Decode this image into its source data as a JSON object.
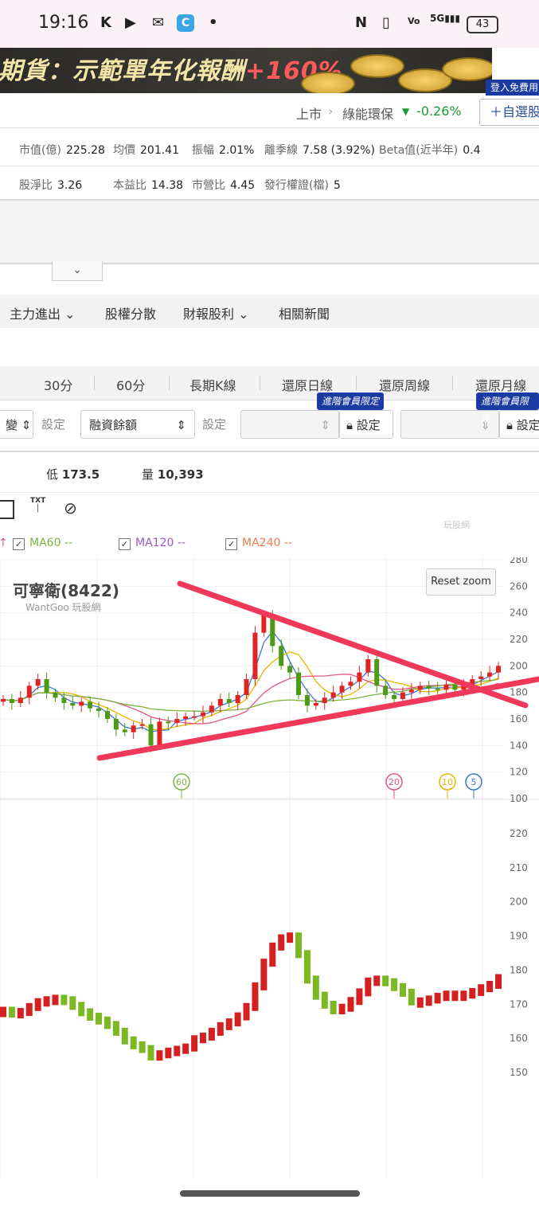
{
  "status_bar": {
    "time": "19:16",
    "app_icons": [
      "K",
      "youtube-icon",
      "chat-icon",
      "browser-icon"
    ],
    "battery": "43",
    "network": "5G"
  },
  "banner": {
    "text": "期貨：示範單年化報酬",
    "highlight": "+160%",
    "tag": "登入免費用"
  },
  "market": {
    "exchange": "上市",
    "sector": "綠能環保",
    "change": "-0.26%",
    "change_color": "#1a9a3a",
    "add_fav": "＋自選股"
  },
  "stats_row1": [
    {
      "label": "市值(億)",
      "value": "225.28"
    },
    {
      "label": "均價",
      "value": "201.41"
    },
    {
      "label": "振幅",
      "value": "2.01%"
    },
    {
      "label": "離季線",
      "value": "7.58 (3.92%)"
    },
    {
      "label": "Beta值(近半年)",
      "value": "0.4"
    }
  ],
  "stats_row2": [
    {
      "label": "股淨比",
      "value": "3.26"
    },
    {
      "label": "本益比",
      "value": "14.38"
    },
    {
      "label": "市營比",
      "value": "4.45"
    },
    {
      "label": "發行權證(檔)",
      "value": "5"
    }
  ],
  "tabs": [
    {
      "label": "主力進出 ⌄"
    },
    {
      "label": "股權分散"
    },
    {
      "label": "財報股利 ⌄"
    },
    {
      "label": "相關新聞"
    }
  ],
  "periods": [
    "30分",
    "60分",
    "長期K線",
    "還原日線",
    "還原周線",
    "還原月線"
  ],
  "indicator_controls": {
    "select1": "變",
    "set_label": "設定",
    "select2": "融資餘額",
    "vip_tag": "進階會員限定",
    "locked_set": "設定"
  },
  "quote_line": {
    "low_label": "低",
    "low": "173.5",
    "vol_label": "量",
    "vol": "10,393"
  },
  "legend": [
    {
      "label": "MA60 --",
      "color": "#7cb342"
    },
    {
      "label": "MA120 --",
      "color": "#9b59c6"
    },
    {
      "label": "MA240 --",
      "color": "#ef7c4a"
    }
  ],
  "reset_zoom": "Reset zoom",
  "chart_title": "可寧衛(8422)",
  "chart_subtitle": "WantGoo 玩股網",
  "watermark": "玩股網",
  "price_axis_ticks": [
    "280",
    "260",
    "240",
    "220",
    "200",
    "180",
    "160",
    "140",
    "120",
    "100"
  ],
  "lower_axis_ticks": [
    "220",
    "210",
    "200",
    "190",
    "180",
    "170",
    "160",
    "150"
  ],
  "markers": [
    {
      "label": "60",
      "color": "#7cb342"
    },
    {
      "label": "20",
      "color": "#e0558a"
    },
    {
      "label": "10",
      "color": "#e6b800"
    },
    {
      "label": "5",
      "color": "#3a79d0"
    }
  ],
  "chart_data": {
    "type": "candlestick",
    "title": "可寧衛(8422)",
    "ylim": [
      100,
      280
    ],
    "closes_approx": [
      175,
      172,
      176,
      185,
      190,
      180,
      176,
      172,
      170,
      173,
      168,
      166,
      160,
      152,
      150,
      155,
      156,
      140,
      158,
      157,
      160,
      162,
      162,
      165,
      170,
      175,
      172,
      178,
      190,
      225,
      238,
      215,
      200,
      195,
      178,
      170,
      172,
      176,
      180,
      185,
      188,
      195,
      205,
      185,
      178,
      175,
      180,
      182,
      185,
      183,
      182,
      186,
      182,
      185,
      190,
      192,
      195,
      200
    ],
    "lower_series": {
      "type": "bar",
      "ylim": [
        145,
        225
      ]
    }
  }
}
